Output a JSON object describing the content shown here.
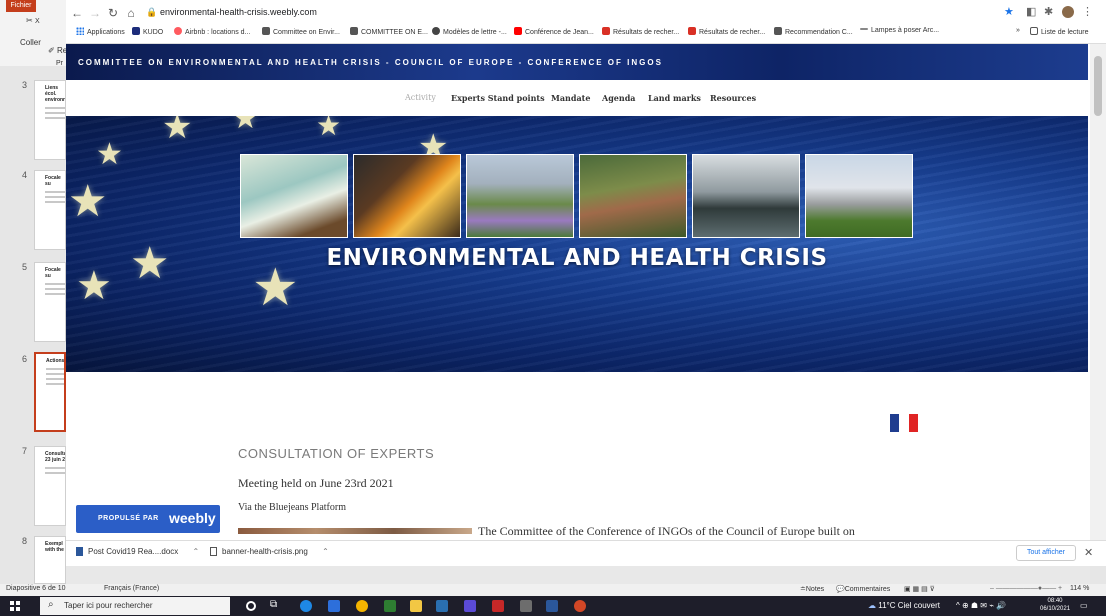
{
  "browser": {
    "url": "environmental-health-crisis.weebly.com",
    "bookmarks": [
      {
        "label": "Applications",
        "icon": "apps-icon",
        "color": "#1a73e8"
      },
      {
        "label": "KUDO",
        "icon": "kudo-icon",
        "color": "#1c2c7a"
      },
      {
        "label": "Airbnb : locations d...",
        "icon": "airbnb-icon",
        "color": "#ff5a5f"
      },
      {
        "label": "Committee on Envir...",
        "icon": "weebly-icon",
        "color": "#555555"
      },
      {
        "label": "COMMITTEE ON E...",
        "icon": "weebly-icon",
        "color": "#555555"
      },
      {
        "label": "Modèles de lettre -...",
        "icon": "globe-icon",
        "color": "#444444"
      },
      {
        "label": "Conférence de Jean...",
        "icon": "youtube-icon",
        "color": "#ff0000"
      },
      {
        "label": "Résultats de recher...",
        "icon": "gmail-icon",
        "color": "#d93025"
      },
      {
        "label": "Résultats de recher...",
        "icon": "gmail-icon",
        "color": "#d93025"
      },
      {
        "label": "Recommendation C...",
        "icon": "weebly-icon",
        "color": "#555555"
      },
      {
        "label": "Lampes à poser Arc...",
        "icon": "dash-icon",
        "color": "#888888"
      }
    ],
    "reading_list": "Liste de lecture",
    "more": "»"
  },
  "site": {
    "header_title": "COMMITTEE ON ENVIRONMENTAL AND HEALTH CRISIS - COUNCIL OF EUROPE - CONFERENCE OF INGOS",
    "nav": [
      "Activity",
      "Experts Stand points",
      "Mandate",
      "Agenda",
      "Land marks",
      "Resources"
    ],
    "banner_title": "ENVIRONMENTAL AND HEALTH CRISIS",
    "section_title": "CONSULTATION OF EXPERTS",
    "meeting": "Meeting held on June 23rd 2021",
    "via": "Via the Bluejeans Platform",
    "body_start": "The Committee of the Conference of INGOs of the Council of Europe built on",
    "badge_prefix": "PROPULSÉ PAR",
    "badge_brand": "weebly",
    "accent": "#2b5ec7"
  },
  "downloads": {
    "items": [
      "Post Covid19 Rea....docx",
      "banner-health-crisis.png"
    ],
    "show_all": "Tout afficher"
  },
  "ppt": {
    "file_tab": "Fichier",
    "paste": "Coller",
    "reproduce": "Re",
    "pr": "Pr",
    "thumbs": [
      {
        "num": "3",
        "title": "Liens écol. environne"
      },
      {
        "num": "4",
        "title": "Focale su"
      },
      {
        "num": "5",
        "title": "Focale su"
      },
      {
        "num": "6",
        "title": "Actions"
      },
      {
        "num": "7",
        "title": "Consulta 23 juin 2"
      },
      {
        "num": "8",
        "title": "Exempl with the"
      }
    ],
    "status_slide": "Diapositive 6 de 10",
    "status_lang": "Français (France)",
    "notes": "Notes",
    "comments": "Commentaires",
    "zoom": "114 %"
  },
  "taskbar": {
    "search_placeholder": "Taper ici pour rechercher",
    "weather": "11°C  Ciel couvert",
    "time": "08:40",
    "date": "06/10/2021"
  }
}
